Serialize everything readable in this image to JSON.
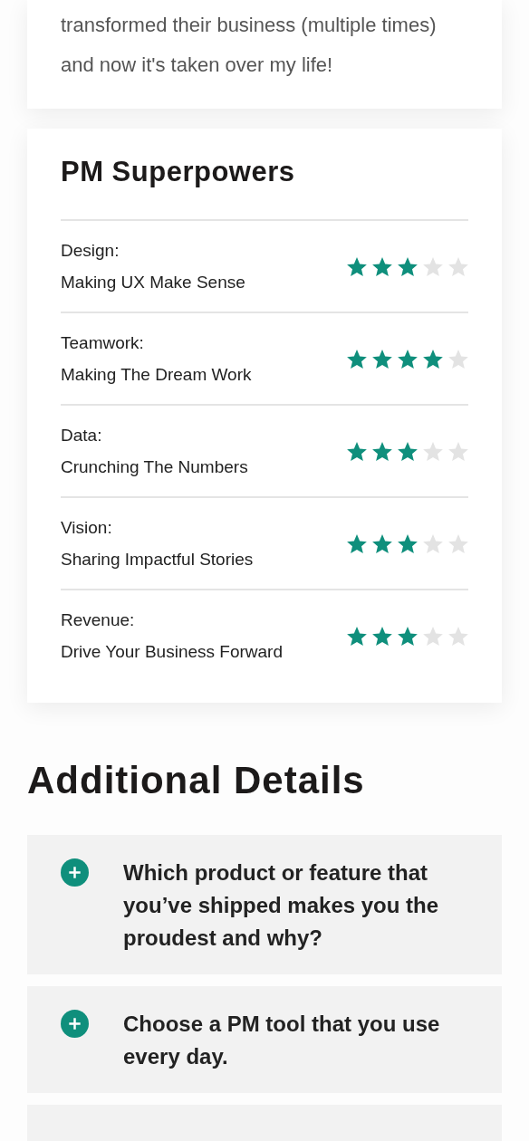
{
  "intro_card": {
    "text": "transformed their business (multiple times) and now it's taken over my life!"
  },
  "superpowers": {
    "title": "PM Superpowers",
    "rows": [
      {
        "category": "Design:",
        "description": "Making UX Make Sense",
        "stars": 3
      },
      {
        "category": "Teamwork:",
        "description": "Making The Dream Work",
        "stars": 4
      },
      {
        "category": "Data:",
        "description": "Crunching The Numbers",
        "stars": 3
      },
      {
        "category": "Vision:",
        "description": "Sharing Impactful Stories",
        "stars": 3
      },
      {
        "category": "Revenue:",
        "description": "Drive Your Business Forward",
        "stars": 3
      }
    ]
  },
  "additional_details": {
    "title": "Additional Details",
    "items": [
      {
        "question": "Which product or feature that you’ve shipped makes you the proudest and why?",
        "expanded": false
      },
      {
        "question": "Choose a PM tool that you use every day.",
        "expanded": false
      }
    ]
  }
}
